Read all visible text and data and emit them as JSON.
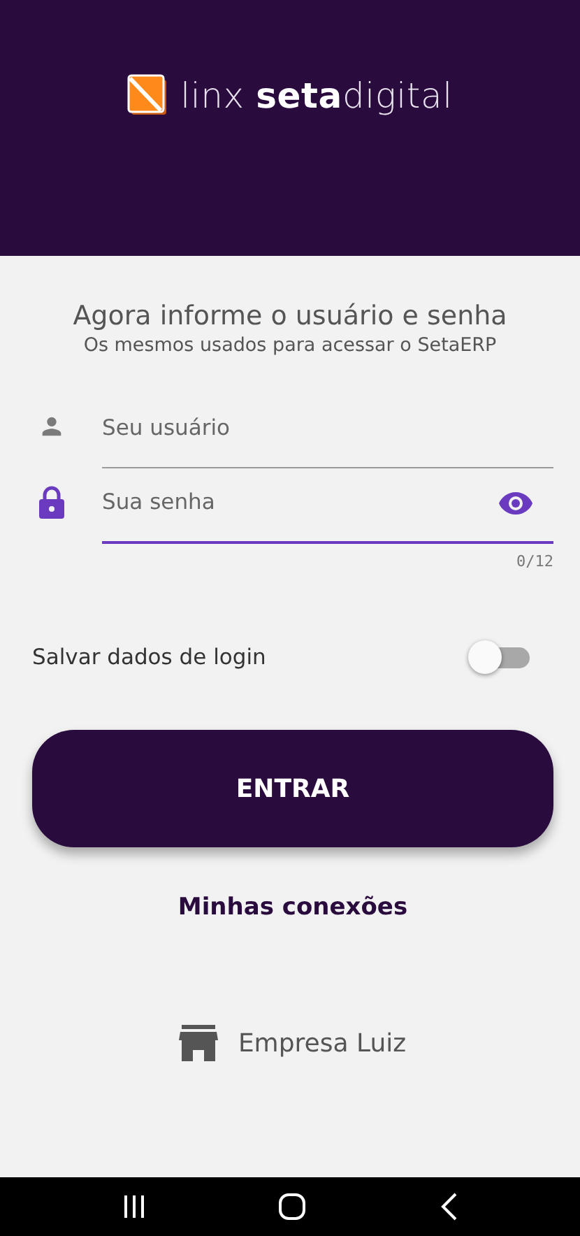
{
  "header": {
    "logo_text": "linx **seta**digital"
  },
  "intro": {
    "title": "Agora informe o usuário e senha",
    "subtitle": "Os mesmos usados para acessar o SetaERP"
  },
  "fields": [
    {
      "kind": "user",
      "placeholder": "Seu usuário",
      "focused": false
    },
    {
      "kind": "password",
      "placeholder": "Sua senha",
      "focused": true,
      "counter": "0/12"
    }
  ],
  "save_login": {
    "label": "Salvar dados de login",
    "on": false
  },
  "submit_button": "ENTRAR",
  "connections_link": "Minhas conexões",
  "company": "Empresa Luiz"
}
